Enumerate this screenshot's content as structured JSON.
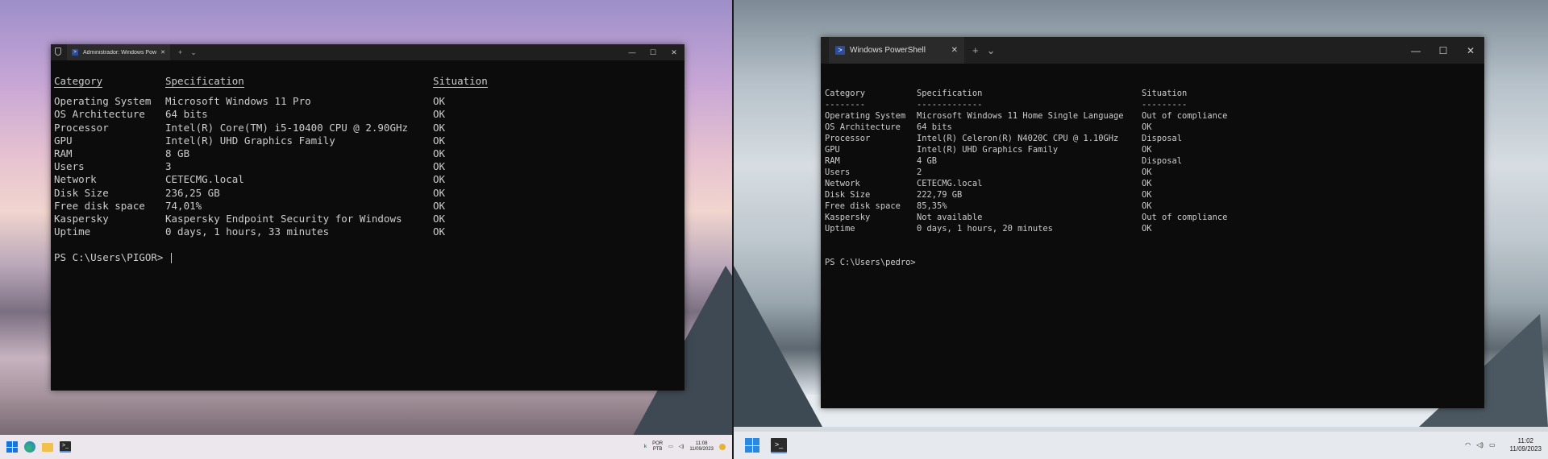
{
  "left": {
    "window": {
      "tab_title": "Administrador: Windows Pow",
      "tab_icon": "powershell-icon",
      "close": "✕",
      "new_tab": "+",
      "dropdown": "⌄",
      "minimize": "—",
      "maximize": "☐",
      "closewin": "✕"
    },
    "headers": {
      "c1": "Category",
      "c2": "Specification",
      "c3": "Situation"
    },
    "rows": [
      {
        "c1": "Operating System",
        "c2": "Microsoft Windows 11 Pro",
        "c3": "OK"
      },
      {
        "c1": "OS Architecture",
        "c2": "64 bits",
        "c3": "OK"
      },
      {
        "c1": "Processor",
        "c2": "Intel(R) Core(TM) i5-10400 CPU @ 2.90GHz",
        "c3": "OK"
      },
      {
        "c1": "GPU",
        "c2": "Intel(R) UHD Graphics Family",
        "c3": "OK"
      },
      {
        "c1": "RAM",
        "c2": "8 GB",
        "c3": "OK"
      },
      {
        "c1": "Users",
        "c2": "3",
        "c3": "OK"
      },
      {
        "c1": "Network",
        "c2": "CETECMG.local",
        "c3": "OK"
      },
      {
        "c1": "Disk Size",
        "c2": "236,25 GB",
        "c3": "OK"
      },
      {
        "c1": "Free disk space",
        "c2": "74,01%",
        "c3": "OK"
      },
      {
        "c1": "Kaspersky",
        "c2": "Kaspersky Endpoint Security for Windows",
        "c3": "OK"
      },
      {
        "c1": "Uptime",
        "c2": "0 days, 1 hours, 33 minutes",
        "c3": "OK"
      }
    ],
    "prompt": "PS C:\\Users\\PIGOR> ",
    "taskbar": {
      "lang_top": "POR",
      "lang_bottom": "PTB",
      "time": "11:08",
      "date": "11/09/2023"
    }
  },
  "right": {
    "window": {
      "tab_title": "Windows PowerShell",
      "tab_icon": "powershell-icon",
      "close": "✕",
      "new_tab": "+",
      "dropdown": "⌄",
      "minimize": "—",
      "maximize": "☐",
      "closewin": "✕"
    },
    "headers": {
      "c1": "Category",
      "c2": "Specification",
      "c3": "Situation"
    },
    "dashes": {
      "c1": "--------",
      "c2": "-------------",
      "c3": "---------"
    },
    "rows": [
      {
        "c1": "Operating System",
        "c2": "Microsoft Windows 11 Home Single Language",
        "c3": "Out of compliance"
      },
      {
        "c1": "OS Architecture",
        "c2": "64 bits",
        "c3": "OK"
      },
      {
        "c1": "Processor",
        "c2": "Intel(R) Celeron(R) N4020C CPU @ 1.10GHz",
        "c3": "Disposal"
      },
      {
        "c1": "GPU",
        "c2": "Intel(R) UHD Graphics Family",
        "c3": "OK"
      },
      {
        "c1": "RAM",
        "c2": "4 GB",
        "c3": "Disposal"
      },
      {
        "c1": "Users",
        "c2": "2",
        "c3": "OK"
      },
      {
        "c1": "Network",
        "c2": "CETECMG.local",
        "c3": "OK"
      },
      {
        "c1": "Disk Size",
        "c2": "222,79 GB",
        "c3": "OK"
      },
      {
        "c1": "Free disk space",
        "c2": "85,35%",
        "c3": "OK"
      },
      {
        "c1": "Kaspersky",
        "c2": "Not available",
        "c3": "Out of compliance"
      },
      {
        "c1": "Uptime",
        "c2": "0 days, 1 hours, 20 minutes",
        "c3": "OK"
      }
    ],
    "prompt": "PS C:\\Users\\pedro>",
    "taskbar": {
      "time": "11:02",
      "date": "11/09/2023"
    }
  }
}
